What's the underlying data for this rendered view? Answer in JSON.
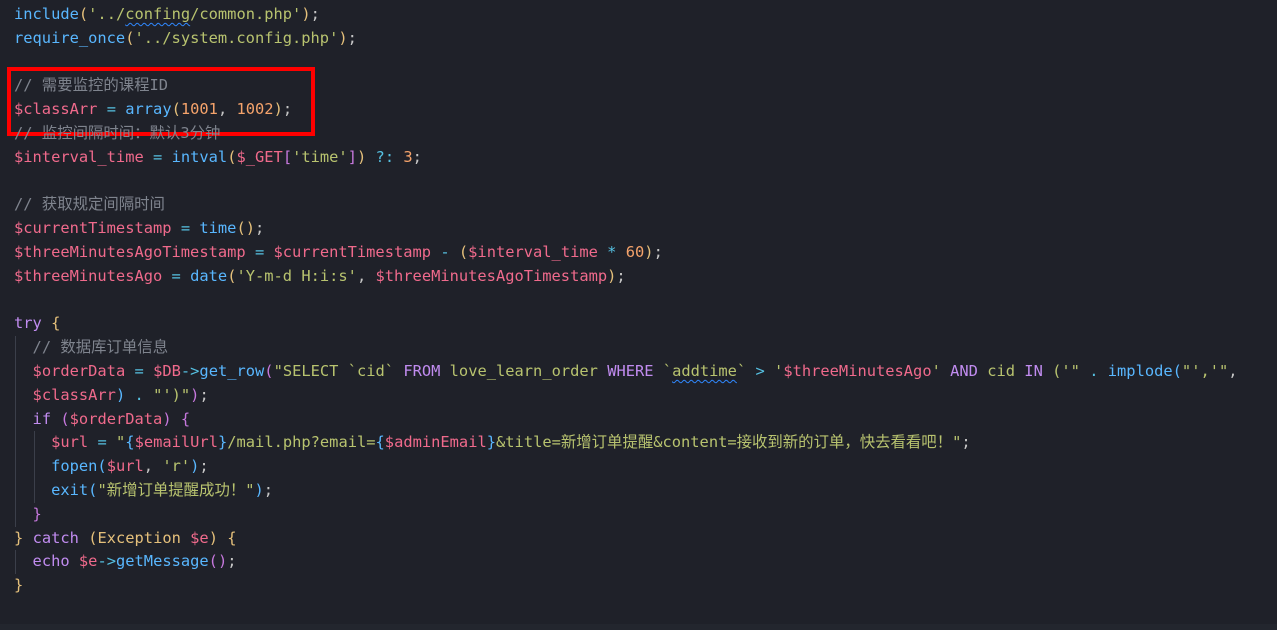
{
  "editor": {
    "language": "php",
    "highlight_color": "#ff0000",
    "background": "#1f2129",
    "lines": [
      {
        "id": "l1",
        "segments": [
          [
            "fn",
            "include"
          ],
          [
            "br1",
            "("
          ],
          [
            "str",
            "'../"
          ],
          [
            "strsq",
            "confing"
          ],
          [
            "str",
            "/common.php'"
          ],
          [
            "br1",
            ")"
          ],
          [
            "punc",
            ";"
          ]
        ]
      },
      {
        "id": "l2",
        "segments": [
          [
            "fn",
            "require_once"
          ],
          [
            "br1",
            "("
          ],
          [
            "str",
            "'../system.config.php'"
          ],
          [
            "br1",
            ")"
          ],
          [
            "punc",
            ";"
          ]
        ]
      },
      {
        "id": "l3",
        "segments": []
      },
      {
        "id": "l4",
        "segments": [
          [
            "cmt",
            "// 需要监控的课程ID"
          ]
        ]
      },
      {
        "id": "l5",
        "segments": [
          [
            "var",
            "$classArr"
          ],
          [
            "punc",
            " "
          ],
          [
            "op",
            "="
          ],
          [
            "punc",
            " "
          ],
          [
            "fn",
            "array"
          ],
          [
            "br1",
            "("
          ],
          [
            "num",
            "1001"
          ],
          [
            "punc",
            ", "
          ],
          [
            "num",
            "1002"
          ],
          [
            "br1",
            ")"
          ],
          [
            "punc",
            ";"
          ]
        ]
      },
      {
        "id": "l6",
        "segments": [
          [
            "cmt",
            "// 监控间隔时间：默认3分钟"
          ]
        ]
      },
      {
        "id": "l7",
        "segments": [
          [
            "var",
            "$interval_time"
          ],
          [
            "punc",
            " "
          ],
          [
            "op",
            "="
          ],
          [
            "punc",
            " "
          ],
          [
            "fn",
            "intval"
          ],
          [
            "br1",
            "("
          ],
          [
            "var",
            "$_GET"
          ],
          [
            "br2",
            "["
          ],
          [
            "str",
            "'time'"
          ],
          [
            "br2",
            "]"
          ],
          [
            "br1",
            ")"
          ],
          [
            "punc",
            " "
          ],
          [
            "op",
            "?:"
          ],
          [
            "punc",
            " "
          ],
          [
            "num",
            "3"
          ],
          [
            "punc",
            ";"
          ]
        ]
      },
      {
        "id": "l8",
        "segments": []
      },
      {
        "id": "l9",
        "segments": [
          [
            "cmt",
            "// 获取规定间隔时间"
          ]
        ]
      },
      {
        "id": "l10",
        "segments": [
          [
            "var",
            "$currentTimestamp"
          ],
          [
            "punc",
            " "
          ],
          [
            "op",
            "="
          ],
          [
            "punc",
            " "
          ],
          [
            "fn",
            "time"
          ],
          [
            "br1",
            "()"
          ],
          [
            "punc",
            ";"
          ]
        ]
      },
      {
        "id": "l11",
        "segments": [
          [
            "var",
            "$threeMinutesAgoTimestamp"
          ],
          [
            "punc",
            " "
          ],
          [
            "op",
            "="
          ],
          [
            "punc",
            " "
          ],
          [
            "var",
            "$currentTimestamp"
          ],
          [
            "punc",
            " "
          ],
          [
            "op",
            "-"
          ],
          [
            "punc",
            " "
          ],
          [
            "br1",
            "("
          ],
          [
            "var",
            "$interval_time"
          ],
          [
            "punc",
            " "
          ],
          [
            "op",
            "*"
          ],
          [
            "punc",
            " "
          ],
          [
            "num",
            "60"
          ],
          [
            "br1",
            ")"
          ],
          [
            "punc",
            ";"
          ]
        ]
      },
      {
        "id": "l12",
        "segments": [
          [
            "var",
            "$threeMinutesAgo"
          ],
          [
            "punc",
            " "
          ],
          [
            "op",
            "="
          ],
          [
            "punc",
            " "
          ],
          [
            "fn",
            "date"
          ],
          [
            "br1",
            "("
          ],
          [
            "str",
            "'Y-m-d H:i:s'"
          ],
          [
            "punc",
            ", "
          ],
          [
            "var",
            "$threeMinutesAgoTimestamp"
          ],
          [
            "br1",
            ")"
          ],
          [
            "punc",
            ";"
          ]
        ]
      },
      {
        "id": "l13",
        "segments": []
      },
      {
        "id": "l14",
        "segments": [
          [
            "kw",
            "try"
          ],
          [
            "punc",
            " "
          ],
          [
            "br1",
            "{"
          ]
        ]
      },
      {
        "id": "l15",
        "segments": [
          [
            "punc",
            "  "
          ],
          [
            "cmt",
            "// 数据库订单信息"
          ]
        ]
      },
      {
        "id": "l16",
        "segments": [
          [
            "punc",
            "  "
          ],
          [
            "var",
            "$orderData"
          ],
          [
            "punc",
            " "
          ],
          [
            "op",
            "="
          ],
          [
            "punc",
            " "
          ],
          [
            "var",
            "$DB"
          ],
          [
            "op",
            "->"
          ],
          [
            "fn",
            "get_row"
          ],
          [
            "br2",
            "("
          ],
          [
            "str",
            "\"SELECT `cid` "
          ],
          [
            "sql",
            "FROM"
          ],
          [
            "str",
            " love_learn_order "
          ],
          [
            "sql",
            "WHERE"
          ],
          [
            "str",
            " `"
          ],
          [
            "strsq",
            "addtime"
          ],
          [
            "str",
            "` "
          ],
          [
            "op",
            ">"
          ],
          [
            "str",
            " '"
          ],
          [
            "var",
            "$threeMinutesAgo"
          ],
          [
            "str",
            "' "
          ],
          [
            "sql",
            "AND"
          ],
          [
            "str",
            " cid "
          ],
          [
            "sql",
            "IN"
          ],
          [
            "str",
            " ('\""
          ],
          [
            "punc",
            " "
          ],
          [
            "op",
            "."
          ],
          [
            "punc",
            " "
          ],
          [
            "fn",
            "implode"
          ],
          [
            "br3",
            "("
          ],
          [
            "str",
            "\"','\""
          ],
          [
            "punc",
            ","
          ]
        ]
      },
      {
        "id": "l17",
        "segments": [
          [
            "punc",
            "  "
          ],
          [
            "var",
            "$classArr"
          ],
          [
            "br3",
            ")"
          ],
          [
            "punc",
            " "
          ],
          [
            "op",
            "."
          ],
          [
            "punc",
            " "
          ],
          [
            "str",
            "\"')\""
          ],
          [
            "br2",
            ")"
          ],
          [
            "punc",
            ";"
          ]
        ]
      },
      {
        "id": "l18",
        "segments": [
          [
            "punc",
            "  "
          ],
          [
            "kw",
            "if"
          ],
          [
            "punc",
            " "
          ],
          [
            "br2",
            "("
          ],
          [
            "var",
            "$orderData"
          ],
          [
            "br2",
            ")"
          ],
          [
            "punc",
            " "
          ],
          [
            "br2",
            "{"
          ]
        ]
      },
      {
        "id": "l19",
        "segments": [
          [
            "punc",
            "    "
          ],
          [
            "var",
            "$url"
          ],
          [
            "punc",
            " "
          ],
          [
            "op",
            "="
          ],
          [
            "punc",
            " "
          ],
          [
            "str",
            "\""
          ],
          [
            "br3",
            "{"
          ],
          [
            "var",
            "$emailUrl"
          ],
          [
            "br3",
            "}"
          ],
          [
            "str",
            "/mail.php?email="
          ],
          [
            "br3",
            "{"
          ],
          [
            "var",
            "$adminEmail"
          ],
          [
            "br3",
            "}"
          ],
          [
            "str",
            "&title=新增订单提醒&content=接收到新的订单，快去看看吧！\""
          ],
          [
            "punc",
            ";"
          ]
        ]
      },
      {
        "id": "l20",
        "segments": [
          [
            "punc",
            "    "
          ],
          [
            "fn",
            "fopen"
          ],
          [
            "br3",
            "("
          ],
          [
            "var",
            "$url"
          ],
          [
            "punc",
            ", "
          ],
          [
            "str",
            "'r'"
          ],
          [
            "br3",
            ")"
          ],
          [
            "punc",
            ";"
          ]
        ]
      },
      {
        "id": "l21",
        "segments": [
          [
            "punc",
            "    "
          ],
          [
            "fn",
            "exit"
          ],
          [
            "br3",
            "("
          ],
          [
            "str",
            "\"新增订单提醒成功！\""
          ],
          [
            "br3",
            ")"
          ],
          [
            "punc",
            ";"
          ]
        ]
      },
      {
        "id": "l22",
        "segments": [
          [
            "punc",
            "  "
          ],
          [
            "br2",
            "}"
          ]
        ]
      },
      {
        "id": "l23",
        "segments": [
          [
            "br1",
            "}"
          ],
          [
            "punc",
            " "
          ],
          [
            "kw",
            "catch"
          ],
          [
            "punc",
            " "
          ],
          [
            "br1",
            "("
          ],
          [
            "cls",
            "Exception"
          ],
          [
            "punc",
            " "
          ],
          [
            "var",
            "$e"
          ],
          [
            "br1",
            ")"
          ],
          [
            "punc",
            " "
          ],
          [
            "br1",
            "{"
          ]
        ]
      },
      {
        "id": "l24",
        "segments": [
          [
            "punc",
            "  "
          ],
          [
            "kw",
            "echo"
          ],
          [
            "punc",
            " "
          ],
          [
            "var",
            "$e"
          ],
          [
            "op",
            "->"
          ],
          [
            "fn",
            "getMessage"
          ],
          [
            "br2",
            "()"
          ],
          [
            "punc",
            ";"
          ]
        ]
      },
      {
        "id": "l25",
        "segments": [
          [
            "br1",
            "}"
          ]
        ]
      }
    ]
  }
}
